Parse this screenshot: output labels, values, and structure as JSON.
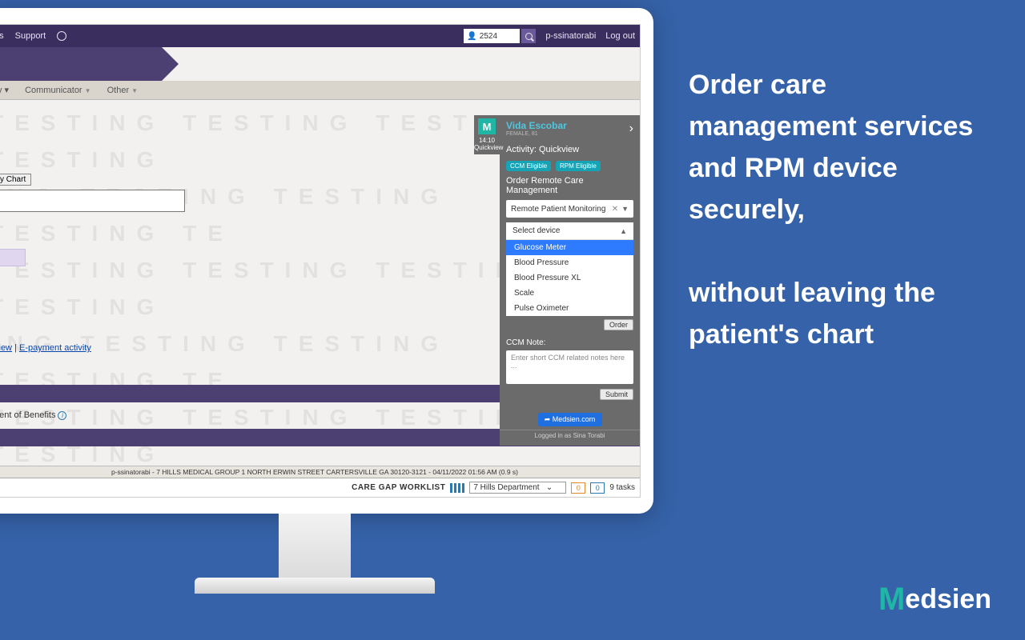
{
  "topbar": {
    "item1": "ps",
    "item2": "Support",
    "search_value": "2524",
    "username": "p-ssinatorabi",
    "logout": "Log out"
  },
  "nav": {
    "item1": "y ▾",
    "item2": "Communicator",
    "item3": "Other"
  },
  "chart_button": "y Chart",
  "links": {
    "view": "view",
    "epay": "E-payment activity"
  },
  "eob": "nent of Benefits",
  "footer_line": "p-ssinatorabi - 7 HILLS MEDICAL GROUP 1 NORTH ERWIN STREET CARTERSVILLE GA 30120-3121 - 04/11/2022 01:56 AM (0.9 s)",
  "bottom": {
    "worklist": "CARE GAP WORKLIST",
    "dept": "7 Hills Department",
    "count1": "0",
    "count2": "0",
    "tasks": "9 tasks"
  },
  "panel": {
    "tab_time": "14:10",
    "tab_label": "Quickview",
    "patient_name": "Vida Escobar",
    "patient_sub": "FEMALE, 81",
    "activity": "Activity: Quickview",
    "badge1": "CCM Eligible",
    "badge2": "RPM Eligible",
    "section_title": "Order Remote Care Management",
    "service_selected": "Remote Patient Monitoring",
    "device_label": "Select device",
    "devices": {
      "d0": "Glucose Meter",
      "d1": "Blood Pressure",
      "d2": "Blood Pressure XL",
      "d3": "Scale",
      "d4": "Pulse Oximeter"
    },
    "order_btn": "Order",
    "note_label": "CCM Note:",
    "note_placeholder": "Enter short CCM related notes here ...",
    "submit_btn": "Submit",
    "medsien_link": "➦ Medsien.com",
    "logged_in": "Logged in as Sina Torabi"
  },
  "headline": "Order care management services and RPM device securely,\n\nwithout leaving the patient's chart",
  "brand": "edsien"
}
